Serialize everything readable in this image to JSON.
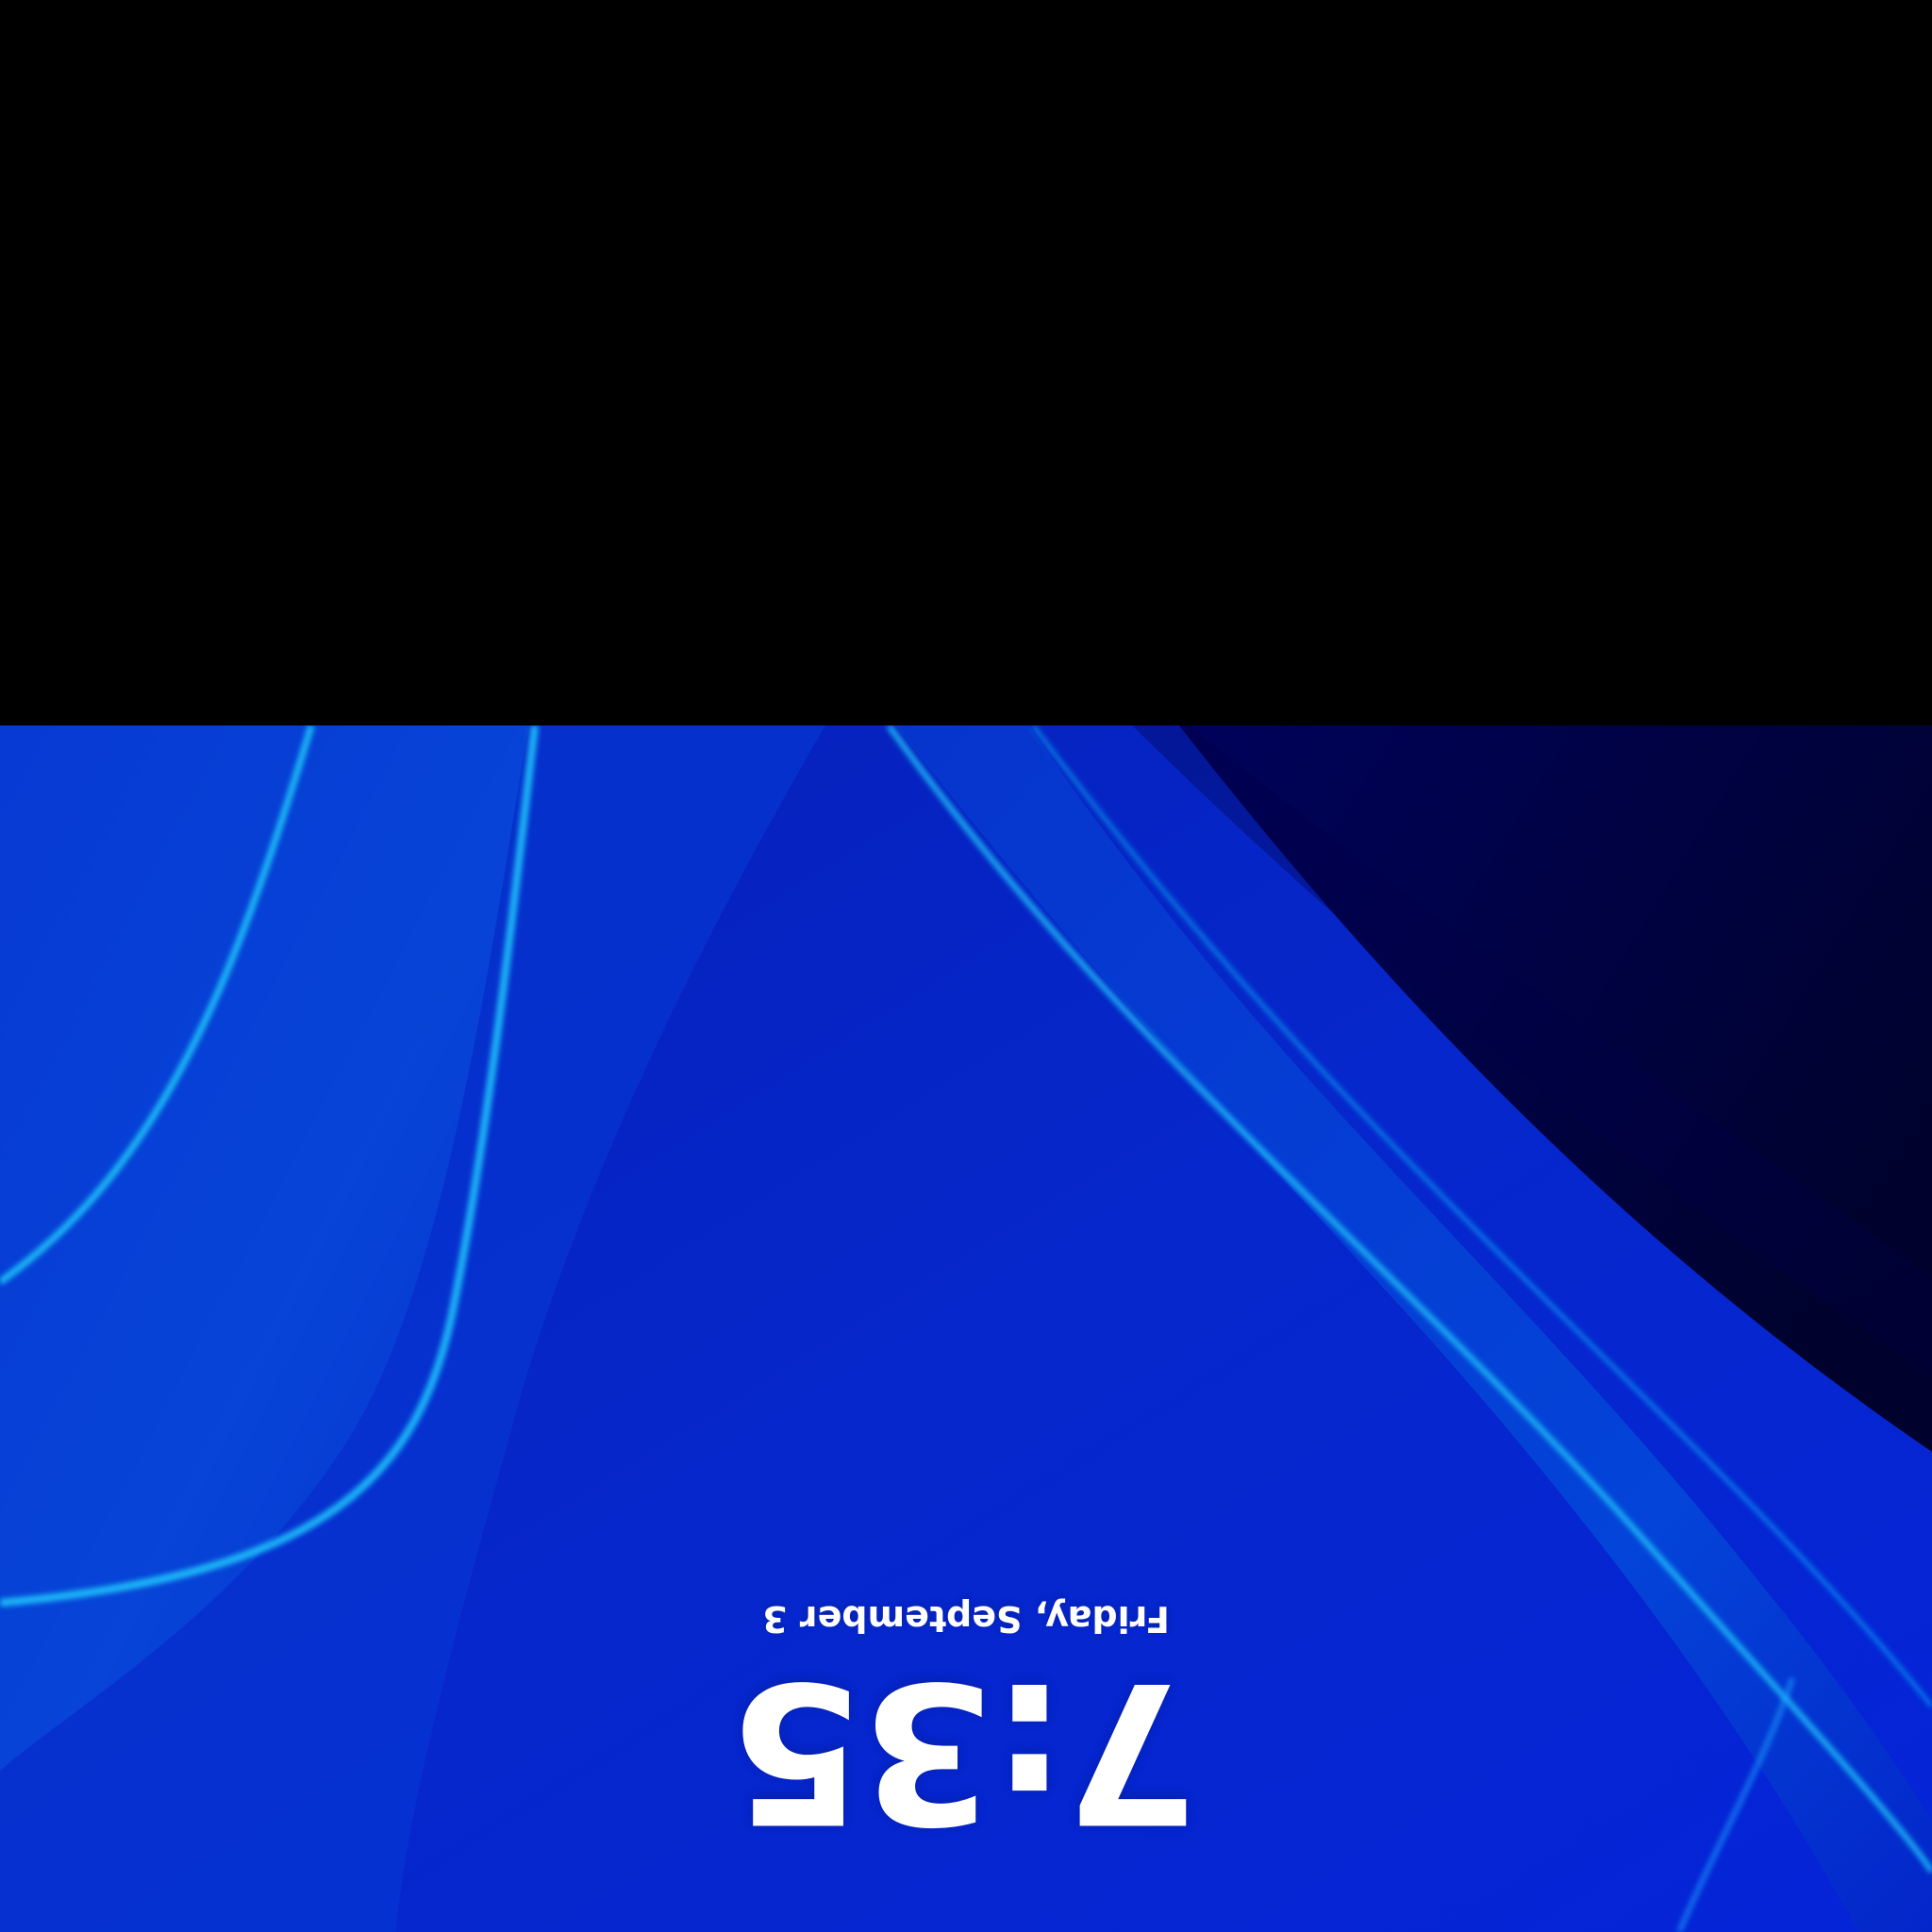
{
  "colors": {
    "top_band": "#000000",
    "wallpaper_base": "#0726c9",
    "wallpaper_dark": "#000036",
    "ribbon_light": "#1ed8ff",
    "ribbon_mid": "#0a5dd9",
    "text": "#ffffff"
  },
  "lock_screen": {
    "time": "7:35",
    "date": "Friday, September 3"
  },
  "orientation": "upside-down"
}
